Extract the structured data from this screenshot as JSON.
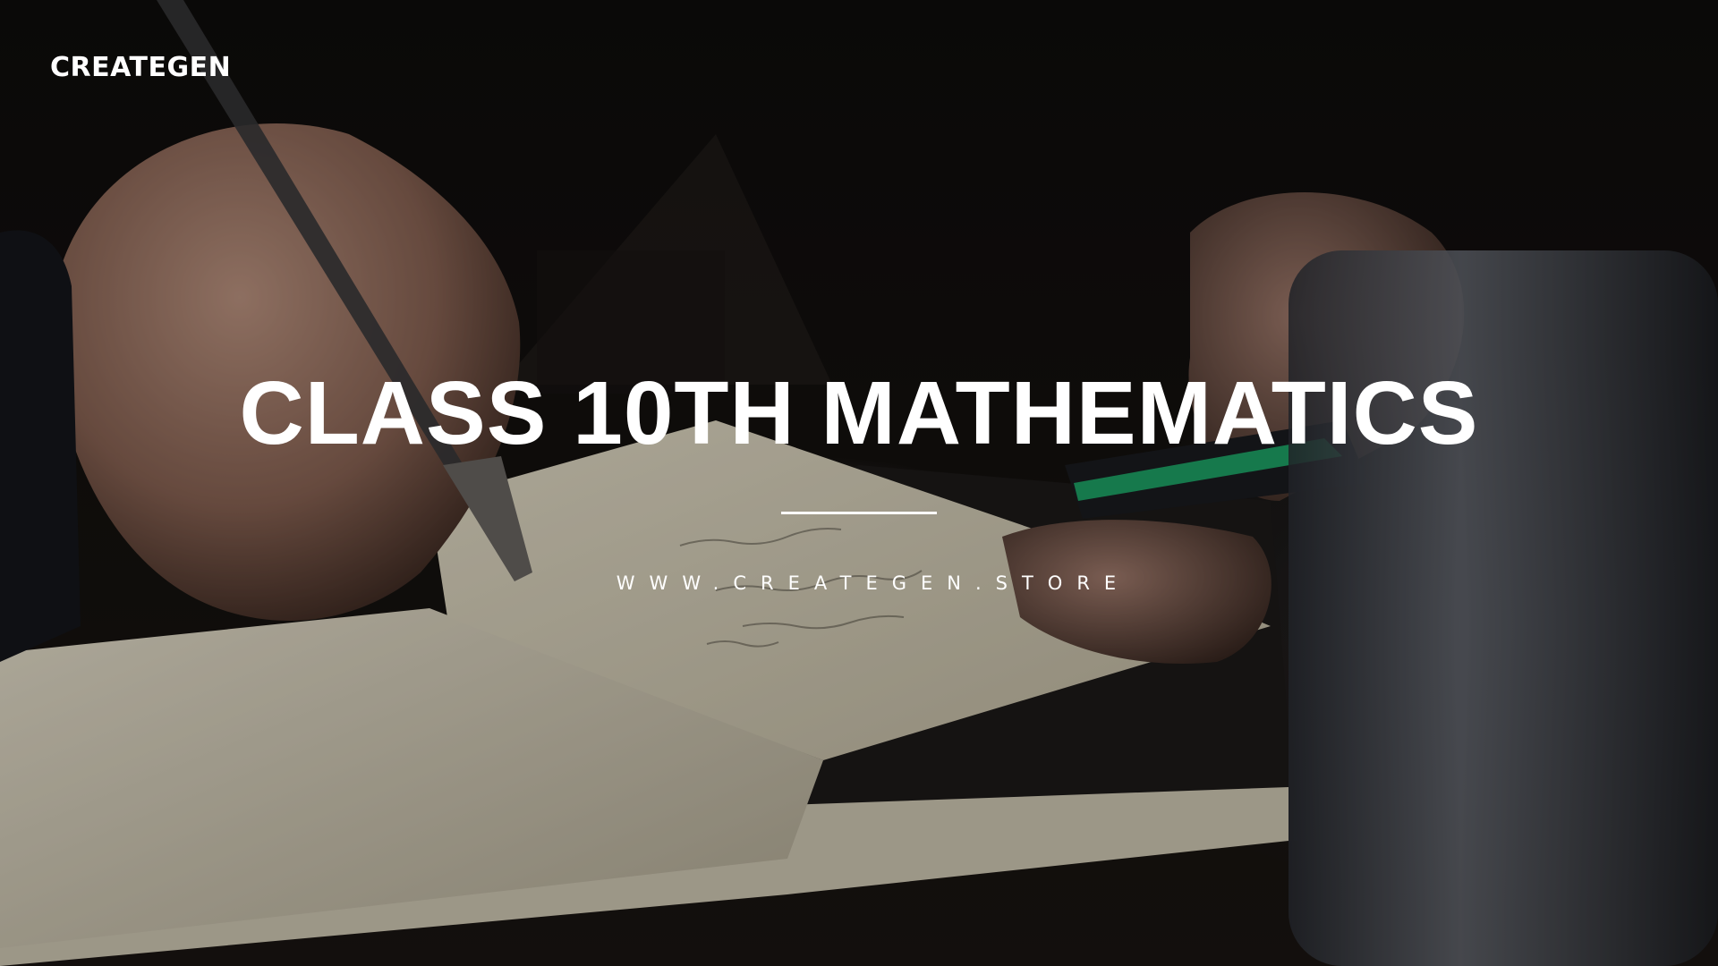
{
  "brand": "CREATEGEN",
  "title": "CLASS 10TH MATHEMATICS",
  "website": "WWW.CREATEGEN.STORE",
  "colors": {
    "text": "#ffffff",
    "overlay": "#000000",
    "accent_green": "#1fa86a"
  }
}
